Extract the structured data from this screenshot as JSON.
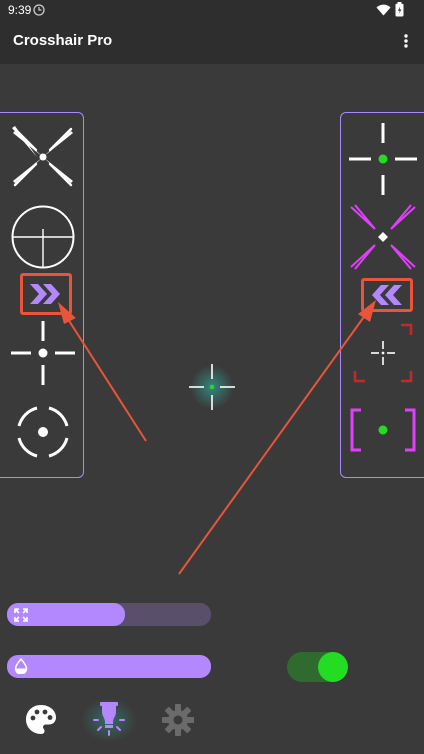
{
  "status_bar": {
    "time": "9:39"
  },
  "app_bar": {
    "title": "Crosshair Pro"
  },
  "sliders": {
    "size_level": 0.58,
    "opacity_level": 1.0
  },
  "toggle": {
    "on": true
  },
  "colors": {
    "accent": "#b388ff",
    "panel_border": "#a78bfa",
    "arrow": "#e8553a",
    "toggle_on": "#22dd22"
  },
  "icons": {
    "status": [
      "clock-icon",
      "wifi-icon",
      "battery-icon"
    ],
    "toolbar": [
      "more-vert-icon"
    ],
    "bottom_nav": [
      "palette-icon",
      "flashlight-icon",
      "settings-gear-icon"
    ],
    "sliders": [
      "resize-icon",
      "opacity-drop-icon"
    ]
  }
}
